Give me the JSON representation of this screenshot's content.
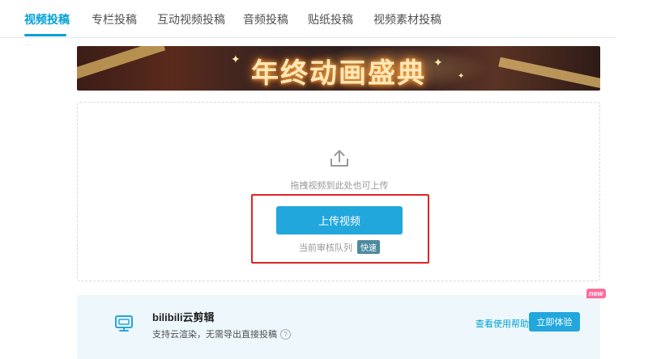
{
  "tabs": [
    {
      "label": "视频投稿",
      "active": true
    },
    {
      "label": "专栏投稿",
      "active": false
    },
    {
      "label": "互动视频投稿",
      "active": false
    },
    {
      "label": "音频投稿",
      "active": false
    },
    {
      "label": "贴纸投稿",
      "active": false
    },
    {
      "label": "视频素材投稿",
      "active": false
    }
  ],
  "banner": {
    "title": "年终动画盛典"
  },
  "upload": {
    "icon": "upload-icon",
    "drag_hint": "拖拽视频到此处也可上传",
    "button_label": "上传视频",
    "queue_label": "当前审核队列",
    "queue_status": "快速"
  },
  "cloud_editor": {
    "icon": "monitor-icon",
    "title": "bilibili云剪辑",
    "description": "支持云渲染，无需导出直接投稿",
    "help_link": "查看使用帮助",
    "try_button": "立即体验",
    "badge": "new"
  },
  "colors": {
    "accent": "#00a1d6",
    "button": "#22a7dd",
    "highlight_border": "#e02424",
    "card_bg": "#eef7fb"
  }
}
